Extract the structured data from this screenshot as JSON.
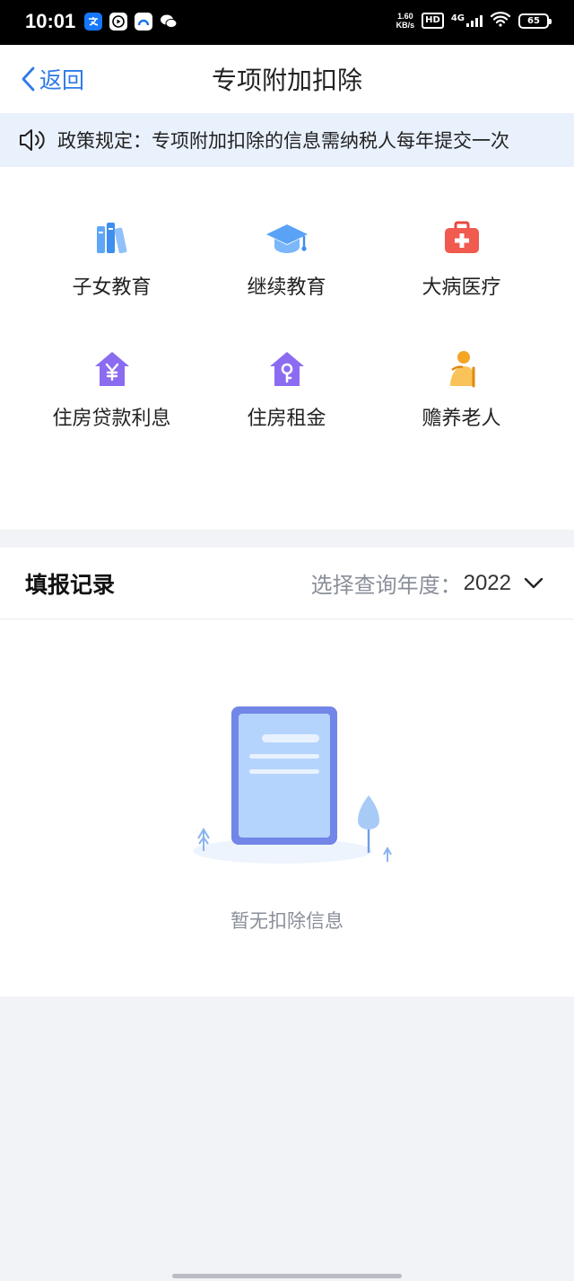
{
  "status_bar": {
    "time": "10:01",
    "speed_value": "1.60",
    "speed_unit": "KB/s",
    "hd": "HD",
    "network": "4G",
    "battery": "65",
    "app_icons": [
      "alipay-icon",
      "video-icon",
      "browser-icon",
      "wechat-icon"
    ]
  },
  "nav": {
    "back_label": "返回",
    "title": "专项附加扣除"
  },
  "notice": {
    "text": "政策规定：专项附加扣除的信息需纳税人每年提交一次"
  },
  "categories": [
    {
      "label": "子女教育",
      "icon": "books-icon"
    },
    {
      "label": "继续教育",
      "icon": "graduation-cap-icon"
    },
    {
      "label": "大病医疗",
      "icon": "medical-kit-icon"
    },
    {
      "label": "住房贷款利息",
      "icon": "house-yuan-icon"
    },
    {
      "label": "住房租金",
      "icon": "house-key-icon"
    },
    {
      "label": "赡养老人",
      "icon": "elderly-person-icon"
    }
  ],
  "records": {
    "title": "填报记录",
    "year_label": "选择查询年度：",
    "year_value": "2022",
    "empty_text": "暂无扣除信息"
  },
  "colors": {
    "accent": "#2f7ae5",
    "notice_bg": "#e9f1fd",
    "house_icon": "#8b6cf0",
    "medical_icon": "#f05a4f",
    "page_bg": "#f2f3f7"
  }
}
